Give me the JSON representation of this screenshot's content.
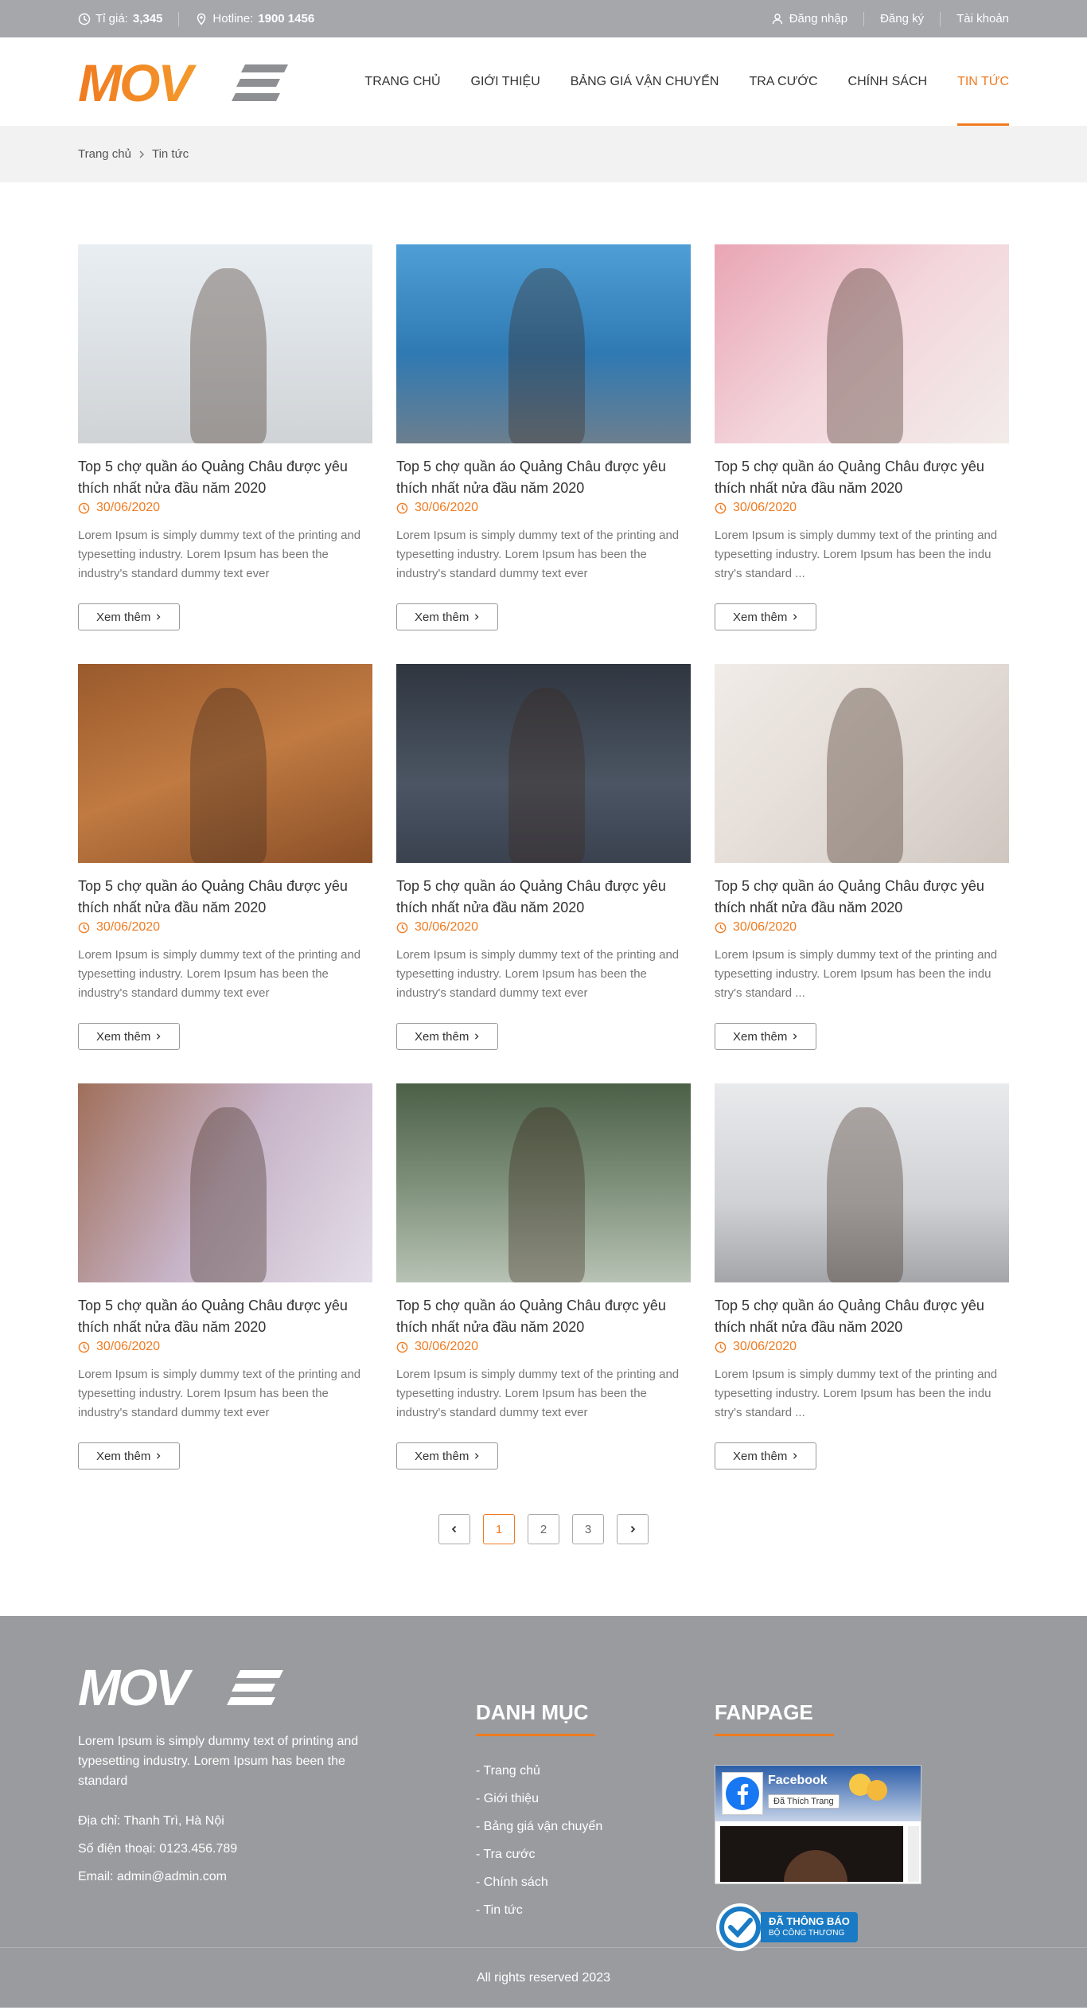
{
  "topbar": {
    "rate_label": "Tỉ giá:",
    "rate_value": "3,345",
    "hotline_label": "Hotline:",
    "hotline_value": "1900 1456",
    "login": "Đăng nhập",
    "register": "Đăng ký",
    "account": "Tài khoản"
  },
  "header": {
    "logo_text": "MOVE",
    "nav": [
      {
        "label": "TRANG CHỦ"
      },
      {
        "label": "GIỚI THIỆU"
      },
      {
        "label": "BẢNG GIÁ VẬN CHUYỂN"
      },
      {
        "label": "TRA CƯỚC"
      },
      {
        "label": "CHÍNH SÁCH"
      },
      {
        "label": "TIN TỨC"
      }
    ],
    "active_index": 5
  },
  "breadcrumb": {
    "home": "Trang chủ",
    "current": "Tin tức"
  },
  "articles": [
    {
      "title": "Top 5 chợ quần áo Quảng Châu được yêu thích nhất nửa đầu năm 2020",
      "date": "30/06/2020",
      "excerpt": "Lorem Ipsum is simply dummy text of the printing and typesetting industry. Lorem Ipsum has been the industry's standard dummy text ever",
      "more": "Xem thêm"
    },
    {
      "title": "Top 5 chợ quần áo Quảng Châu được yêu thích nhất nửa đầu năm 2020",
      "date": "30/06/2020",
      "excerpt": "Lorem Ipsum is simply dummy text of the printing and typesetting industry. Lorem Ipsum has been the industry's standard dummy text ever",
      "more": "Xem thêm"
    },
    {
      "title": "Top 5 chợ quần áo Quảng Châu được yêu thích nhất nửa đầu năm 2020",
      "date": "30/06/2020",
      "excerpt": "Lorem Ipsum is simply dummy text of the printing and typesetting industry. Lorem Ipsum has been the indu stry's standard ...",
      "more": "Xem thêm"
    },
    {
      "title": "Top 5 chợ quần áo Quảng Châu được yêu thích nhất nửa đầu năm 2020",
      "date": "30/06/2020",
      "excerpt": "Lorem Ipsum is simply dummy text of the printing and typesetting industry. Lorem Ipsum has been the industry's standard dummy text ever",
      "more": "Xem thêm"
    },
    {
      "title": "Top 5 chợ quần áo Quảng Châu được yêu thích nhất nửa đầu năm 2020",
      "date": "30/06/2020",
      "excerpt": "Lorem Ipsum is simply dummy text of the printing and typesetting industry. Lorem Ipsum has been the industry's standard dummy text ever",
      "more": "Xem thêm"
    },
    {
      "title": "Top 5 chợ quần áo Quảng Châu được yêu thích nhất nửa đầu năm 2020",
      "date": "30/06/2020",
      "excerpt": "Lorem Ipsum is simply dummy text of the printing and typesetting industry. Lorem Ipsum has been the indu stry's standard ...",
      "more": "Xem thêm"
    },
    {
      "title": "Top 5 chợ quần áo Quảng Châu được yêu thích nhất nửa đầu năm 2020",
      "date": "30/06/2020",
      "excerpt": "Lorem Ipsum is simply dummy text of the printing and typesetting industry. Lorem Ipsum has been the industry's standard dummy text ever",
      "more": "Xem thêm"
    },
    {
      "title": "Top 5 chợ quần áo Quảng Châu được yêu thích nhất nửa đầu năm 2020",
      "date": "30/06/2020",
      "excerpt": "Lorem Ipsum is simply dummy text of the printing and typesetting industry. Lorem Ipsum has been the industry's standard dummy text ever",
      "more": "Xem thêm"
    },
    {
      "title": "Top 5 chợ quần áo Quảng Châu được yêu thích nhất nửa đầu năm 2020",
      "date": "30/06/2020",
      "excerpt": "Lorem Ipsum is simply dummy text of the printing and typesetting industry. Lorem Ipsum has been the indu stry's standard ...",
      "more": "Xem thêm"
    }
  ],
  "pagination": {
    "prev": "‹",
    "pages": [
      "1",
      "2",
      "3"
    ],
    "current": "1",
    "next": "›"
  },
  "footer": {
    "logo_text": "MOVE",
    "about": "Lorem Ipsum is simply dummy text of printing and typesetting industry. Lorem Ipsum has been the standard",
    "address": "Địa chỉ: Thanh Trì, Hà Nội",
    "phone": "Số điện thoại: 0123.456.789",
    "email": "Email: admin@admin.com",
    "menu_heading": "DANH MỤC",
    "menu": [
      "- Trang chủ",
      "- Giới thiệu",
      "- Bảng giá vận chuyển",
      "- Tra cước",
      "- Chính sách",
      "- Tin tức"
    ],
    "fanpage_heading": "FANPAGE",
    "fb_name": "Facebook",
    "fb_like": "Đã Thích Trang",
    "bct_line1": "ĐÃ THÔNG BÁO",
    "bct_line2": "BỘ CÔNG THƯƠNG",
    "copyright": "All rights reserved 2023"
  },
  "colors": {
    "accent": "#f07b21",
    "topbar_bg": "#a6a7ab",
    "footer_bg": "#9a9b9e"
  },
  "icons": [
    "clock-icon",
    "pin-icon",
    "user-icon",
    "chevron-right-icon",
    "chevron-left-icon"
  ]
}
